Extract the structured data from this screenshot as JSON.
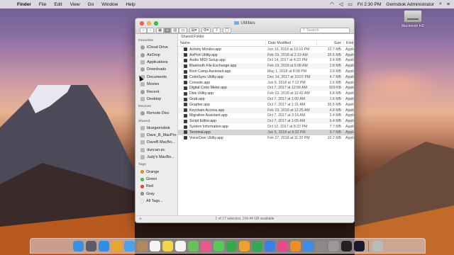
{
  "menubar": {
    "app_name": "Finder",
    "menus": [
      "File",
      "Edit",
      "View",
      "Go",
      "Window",
      "Help"
    ],
    "clock": "Fri 2:30 PM",
    "user": "Gemsbok Administrator"
  },
  "desktop": {
    "disk_label": "Macintosh HD"
  },
  "window": {
    "title": "Utilities",
    "search_placeholder": "Search",
    "path_label": "Shared Folder",
    "status_text": "1 of 17 selected, 194.44 GB available",
    "columns": {
      "name": "Name",
      "date": "Date Modified",
      "size": "Size",
      "kind": "Kind"
    },
    "sidebar": {
      "favorites_heading": "Favorites",
      "favorites": [
        "iCloud Drive",
        "AirDrop",
        "Applications",
        "Downloads",
        "Documents",
        "Movies",
        "Recent",
        "Desktop"
      ],
      "devices_heading": "Devices",
      "devices": [
        "Remote Disc"
      ],
      "shared_heading": "Shared",
      "shared": [
        "bluegemsbok",
        "Dave_B_MacPro",
        "DaveB MacBo...",
        "duncan-pc",
        "Judy's MacBo..."
      ],
      "tags_heading": "Tags",
      "tags": [
        {
          "label": "Orange",
          "color": "#f39a2c"
        },
        {
          "label": "Green",
          "color": "#5ac85a"
        },
        {
          "label": "Red",
          "color": "#f24a4a"
        },
        {
          "label": "Gray",
          "color": "#9a9a9a"
        },
        {
          "label": "All Tags...",
          "color": ""
        }
      ]
    },
    "files": [
      {
        "name": "Activity Monitor.app",
        "date": "Jun 16, 2018 at 10:10 PM",
        "size": "12.7 MB",
        "kind": "Applic"
      },
      {
        "name": "AirPort Utility.app",
        "date": "Feb 19, 2018 at 2:19 AM",
        "size": "35.5 MB",
        "kind": "Applic"
      },
      {
        "name": "Audio MIDI Setup.app",
        "date": "Oct 14, 2017 at 4:23 PM",
        "size": "3.4 MB",
        "kind": "Applic"
      },
      {
        "name": "Bluetooth File Exchange.app",
        "date": "Feb 19, 2018 at 5:08 AM",
        "size": "2.8 MB",
        "kind": "Applic"
      },
      {
        "name": "Boot Camp Assistant.app",
        "date": "May 1, 2018 at 8:08 PM",
        "size": "3.8 MB",
        "kind": "Applic"
      },
      {
        "name": "ColorSync Utility.app",
        "date": "Dec 14, 2017 at 10:07 PM",
        "size": "4.7 MB",
        "kind": "Applic"
      },
      {
        "name": "Console.app",
        "date": "Jun 9, 2018 at 7:12 PM",
        "size": "2.6 MB",
        "kind": "Applic"
      },
      {
        "name": "Digital Color Meter.app",
        "date": "Oct 7, 2017 at 12:56 AM",
        "size": "929 KB",
        "kind": "Applic"
      },
      {
        "name": "Disk Utility.app",
        "date": "Feb 19, 2018 at 12:42 AM",
        "size": "6.8 MB",
        "kind": "Applic"
      },
      {
        "name": "Grab.app",
        "date": "Oct 7, 2017 at 1:00 AM",
        "size": "1.6 MB",
        "kind": "Applic"
      },
      {
        "name": "Grapher.app",
        "date": "Oct 7, 2017 at 1:21 AM",
        "size": "35.5 MB",
        "kind": "Applic"
      },
      {
        "name": "Keychain Access.app",
        "date": "Feb 19, 2018 at 12:25 AM",
        "size": "4.8 MB",
        "kind": "Applic"
      },
      {
        "name": "Migration Assistant.app",
        "date": "Oct 7, 2017 at 3:16 AM",
        "size": "2.4 MB",
        "kind": "Applic"
      },
      {
        "name": "Script Editor.app",
        "date": "Oct 7, 2017 at 1:05 AM",
        "size": "6.4 MB",
        "kind": "Applic"
      },
      {
        "name": "System Information.app",
        "date": "Oct 12, 2017 at 8:22 PM",
        "size": "7.7 MB",
        "kind": "Applic"
      },
      {
        "name": "Terminal.app",
        "date": "Jan 5, 2018 at 9:32 PM",
        "size": "9.7 MB",
        "kind": "Applic"
      },
      {
        "name": "VoiceOver Utility.app",
        "date": "Feb 27, 2018 at 11:20 PM",
        "size": "10.2 MB",
        "kind": "Applic"
      }
    ],
    "selected_index": 15
  },
  "dock": {
    "apps": [
      {
        "icon": "finder-icon",
        "color": "#3d8fe0"
      },
      {
        "icon": "launchpad-icon",
        "color": "#5b5b6b"
      },
      {
        "icon": "safari-icon",
        "color": "#2f8ee8"
      },
      {
        "icon": "chrome-icon",
        "color": "#e8a62a"
      },
      {
        "icon": "mail-icon",
        "color": "#4aa3e8"
      },
      {
        "icon": "contacts-icon",
        "color": "#b08a5a"
      },
      {
        "icon": "calendar-icon",
        "color": "#f4f4f4"
      },
      {
        "icon": "notes-icon",
        "color": "#f4d54a"
      },
      {
        "icon": "reminders-icon",
        "color": "#f4f4f4"
      },
      {
        "icon": "maps-icon",
        "color": "#6cc05a"
      },
      {
        "icon": "photos-icon",
        "color": "#e85a8a"
      },
      {
        "icon": "messages-icon",
        "color": "#5ac85a"
      },
      {
        "icon": "facetime-icon",
        "color": "#3aa84a"
      },
      {
        "icon": "pages-icon",
        "color": "#f0a030"
      },
      {
        "icon": "numbers-icon",
        "color": "#34a853"
      },
      {
        "icon": "keynote-icon",
        "color": "#3a7ee8"
      },
      {
        "icon": "itunes-icon",
        "color": "#e84a8a"
      },
      {
        "icon": "books-icon",
        "color": "#f08a2a"
      },
      {
        "icon": "appstore-icon",
        "color": "#3a8ee8"
      },
      {
        "icon": "preferences-icon",
        "color": "#8a8a8a"
      },
      {
        "icon": "disk-utility-icon",
        "color": "#9a9a9a"
      },
      {
        "icon": "terminal-icon",
        "color": "#222222"
      },
      {
        "icon": "quicktime-icon",
        "color": "#1a1a2a"
      },
      {
        "icon": "trash-icon",
        "color": "#bcbcbc"
      }
    ]
  }
}
